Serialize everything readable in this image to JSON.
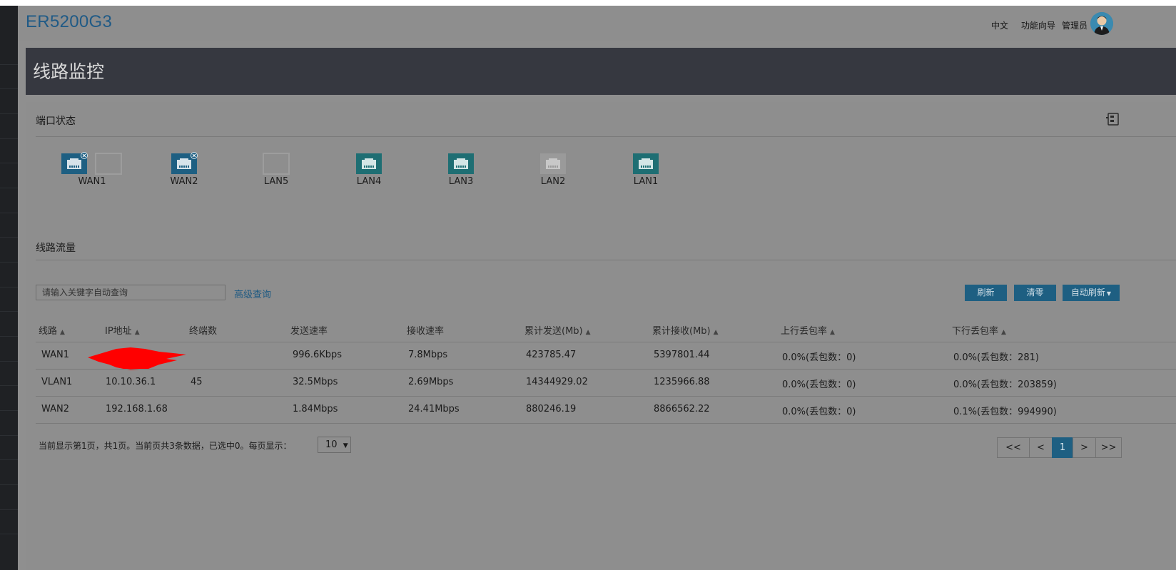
{
  "header": {
    "brand": "ER5200G3",
    "lang": "中文",
    "wizard": "功能向导",
    "user": "管理员"
  },
  "page": {
    "title": "线路监控"
  },
  "port_status": {
    "title": "端口状态",
    "ports": [
      {
        "label": "WAN1",
        "state": "connected-error",
        "color": "#1e5f82"
      },
      {
        "label": "",
        "state": "empty",
        "color": "#7f7f7f"
      },
      {
        "label": "WAN2",
        "state": "connected-error",
        "color": "#1e5f82"
      },
      {
        "label": "LAN5",
        "state": "empty",
        "color": "#7f7f7f"
      },
      {
        "label": "LAN4",
        "state": "connected",
        "color": "#1e6e73"
      },
      {
        "label": "LAN3",
        "state": "connected",
        "color": "#1e6e73"
      },
      {
        "label": "LAN2",
        "state": "disabled",
        "color": "#9a9a9a"
      },
      {
        "label": "LAN1",
        "state": "connected",
        "color": "#1e6e73"
      }
    ]
  },
  "traffic": {
    "title": "线路流量",
    "search_placeholder": "请输入关键字自动查询",
    "advanced": "高级查询",
    "buttons": {
      "refresh": "刷新",
      "clear": "清零",
      "auto_refresh": "自动刷新"
    },
    "columns": [
      "线路",
      "IP地址",
      "终端数",
      "发送速率",
      "接收速率",
      "累计发送(Mb)",
      "累计接收(Mb)",
      "上行丢包率",
      "下行丢包率"
    ],
    "rows": [
      [
        "WAN1",
        "",
        "",
        "996.6Kbps",
        "7.8Mbps",
        "423785.47",
        "5397801.44",
        "0.0%(丢包数：0)",
        "0.0%(丢包数：281)"
      ],
      [
        "VLAN1",
        "10.10.36.1",
        "45",
        "32.5Mbps",
        "2.69Mbps",
        "14344929.02",
        "1235966.88",
        "0.0%(丢包数：0)",
        "0.0%(丢包数：203859)"
      ],
      [
        "WAN2",
        "192.168.1.68",
        "",
        "1.84Mbps",
        "24.41Mbps",
        "880246.19",
        "8866562.22",
        "0.0%(丢包数：0)",
        "0.1%(丢包数：994990)"
      ]
    ]
  },
  "pagination": {
    "summary": "当前显示第1页，共1页。当前页共3条数据，已选中0。每页显示：",
    "page_size": "10",
    "first": "<<",
    "prev": "<",
    "current": "1",
    "next": ">",
    "last": ">>"
  },
  "colors": {
    "accent": "#1e5f82",
    "port_teal": "#1e6e73",
    "title_bar": "#363840",
    "redaction": "#ff0000"
  }
}
